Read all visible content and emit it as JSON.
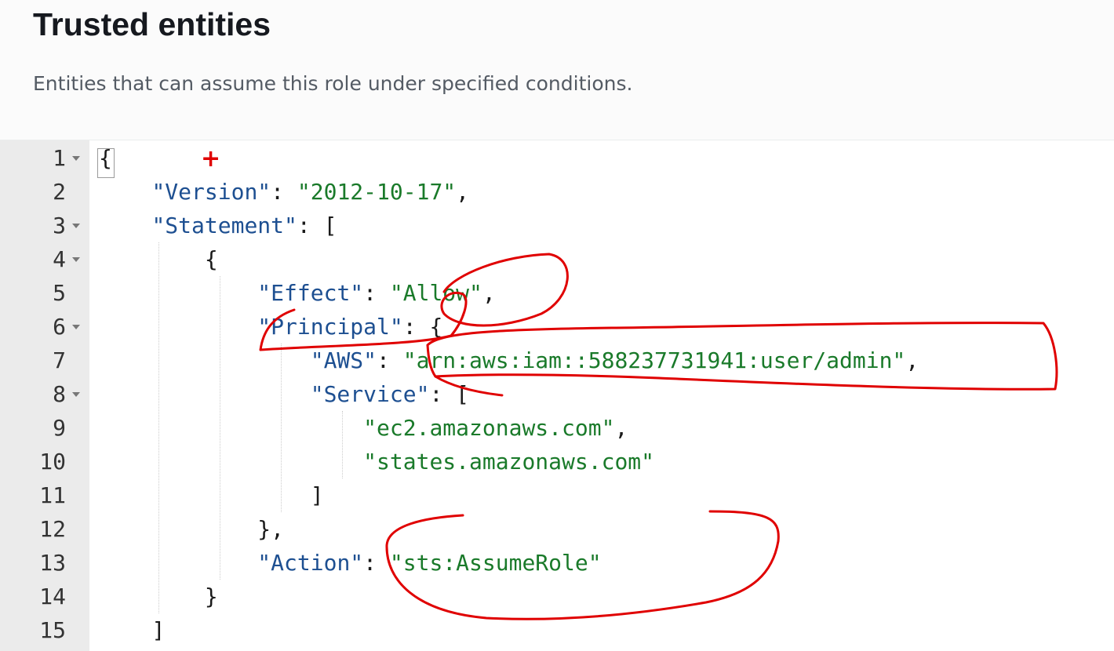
{
  "section": {
    "title": "Trusted entities",
    "description": "Entities that can assume this role under specified conditions."
  },
  "editor": {
    "line_numbers": [
      "1",
      "2",
      "3",
      "4",
      "5",
      "6",
      "7",
      "8",
      "9",
      "10",
      "11",
      "12",
      "13",
      "14",
      "15"
    ],
    "foldable_lines": [
      "1",
      "3",
      "4",
      "6",
      "8"
    ],
    "tokens": {
      "open_brace": "{",
      "version_key": "\"Version\"",
      "version_value": "\"2012-10-17\"",
      "statement_key": "\"Statement\"",
      "open_bracket": "[",
      "stmt_open": "{",
      "effect_key": "\"Effect\"",
      "effect_value": "\"Allow\"",
      "principal_key": "\"Principal\"",
      "principal_open": "{",
      "aws_key": "\"AWS\"",
      "aws_value": "\"arn:aws:iam::588237731941:user/admin\"",
      "service_key": "\"Service\"",
      "service_open": "[",
      "service_1": "\"ec2.amazonaws.com\"",
      "service_2": "\"states.amazonaws.com\"",
      "service_close": "]",
      "principal_close": "},",
      "action_key": "\"Action\"",
      "action_value": "\"sts:AssumeRole\"",
      "stmt_close": "}",
      "close_bracket": "]",
      "colon": ": ",
      "comma": ","
    }
  },
  "annotation": {
    "pen_color": "#e00000",
    "marker": "+"
  }
}
